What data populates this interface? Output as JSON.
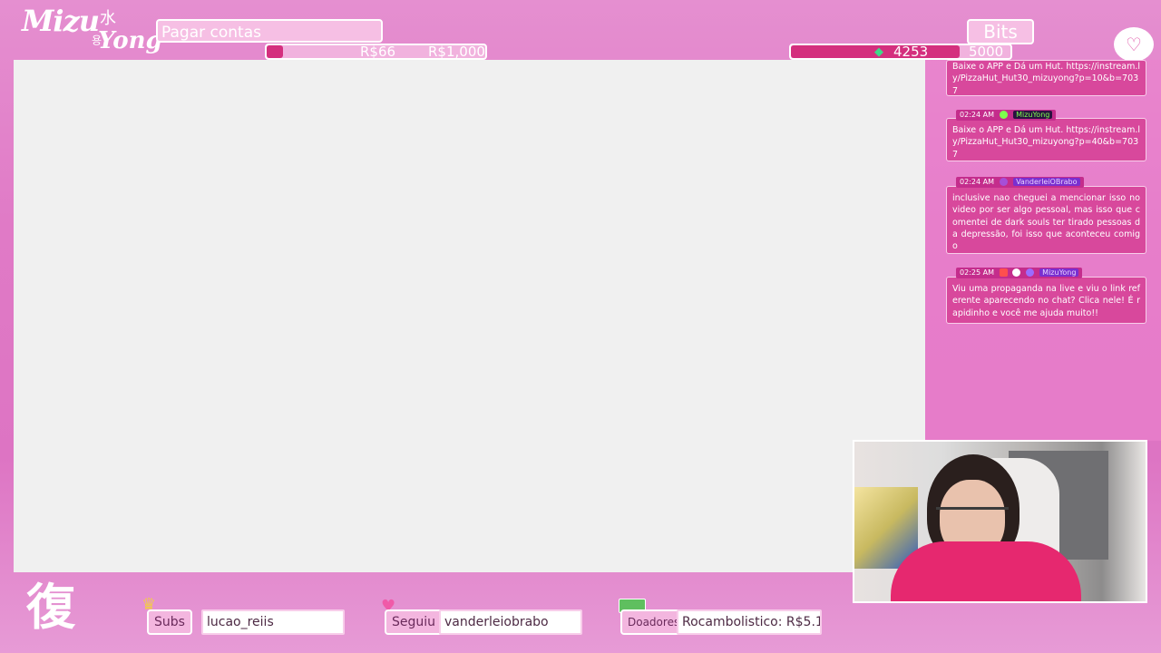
{
  "branding": {
    "logo_main": "Mizu",
    "logo_secondary": "Yong",
    "logo_kanji": "水",
    "logo_hangul": "용",
    "bottom_kanji": "復"
  },
  "goal": {
    "title": "Pagar contas",
    "current": "R$66",
    "target": "R$1,000",
    "progress_fraction": 0.066
  },
  "bits": {
    "title": "Bits",
    "current": "4253",
    "target": "5000",
    "progress_fraction": 0.85
  },
  "chat": {
    "messages": [
      {
        "time": "",
        "user": "",
        "text": "Baixe o APP e Dá um Hut. https://instream.ly/PizzaHut_Hut30_mizuyong?p=10&b=7037"
      },
      {
        "time": "02:24 AM",
        "user": "MizuYong",
        "text": "Baixe o APP e Dá um Hut. https://instream.ly/PizzaHut_Hut30_mizuyong?p=40&b=7037"
      },
      {
        "time": "02:24 AM",
        "user": "VanderleiOBrabo",
        "text": "inclusive nao cheguei a mencionar isso no video por ser algo pessoal, mas isso que comentei de dark souls ter tirado pessoas da depressão, foi isso que aconteceu comigo"
      },
      {
        "time": "02:25 AM",
        "user": "MizuYong",
        "text": "Viu uma propaganda na live e viu o link referente aparecendo no chat? Clica nele! É rapidinho e você me ajuda muito!!"
      }
    ]
  },
  "bottom": {
    "subs_label": "Subs",
    "subs_value": "lucao_reiis",
    "follow_label": "Seguiu",
    "follow_value": "vanderleiobrabo",
    "donors_label": "Doadores",
    "donors_value": "Rocambolistico: R$5.1"
  },
  "colors": {
    "accent": "#d42f7e",
    "panel": "#f6bfe4",
    "background": "#e07ac6"
  }
}
